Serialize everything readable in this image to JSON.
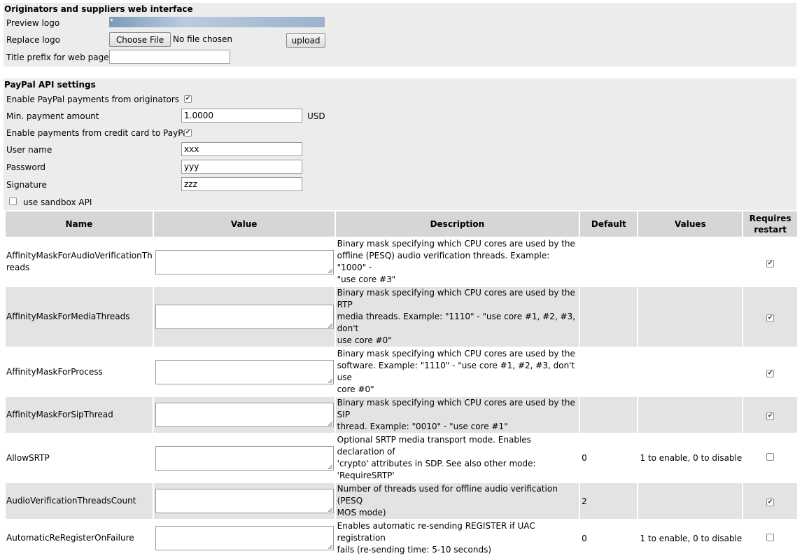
{
  "web_interface": {
    "title": "Originators and suppliers web interface",
    "preview_logo_label": "Preview logo",
    "replace_logo_label": "Replace logo",
    "choose_file_button": "Choose File",
    "no_file_text": "No file chosen",
    "upload_button": "upload",
    "title_prefix_label": "Title prefix for web pages",
    "title_prefix_value": ""
  },
  "paypal": {
    "title": "PayPal API settings",
    "enable_payments_label": "Enable PayPal payments from originators",
    "enable_payments_checked": true,
    "min_payment_label": "Min. payment amount",
    "min_payment_value": "1.0000",
    "currency": "USD",
    "enable_cc_label": "Enable payments from credit card to PayPal",
    "enable_cc_checked": true,
    "username_label": "User name",
    "username_value": "xxx",
    "password_label": "Password",
    "password_value": "yyy",
    "signature_label": "Signature",
    "signature_value": "zzz",
    "sandbox_label": "use sandbox API",
    "sandbox_checked": false
  },
  "settings_table": {
    "headers": {
      "name": "Name",
      "value": "Value",
      "description": "Description",
      "default": "Default",
      "values": "Values",
      "restart_line1": "Requires",
      "restart_line2": "restart"
    },
    "rows": [
      {
        "name_line1": "AffinityMaskForAudioVerificationTh",
        "name_line2": "reads",
        "desc1": "Binary mask specifying which CPU cores are used by the",
        "desc2": "offline (PESQ) audio verification threads. Example: \"1000\" -",
        "desc3": "\"use core #3\"",
        "default": "",
        "values": "",
        "restart": true
      },
      {
        "name_line1": "AffinityMaskForMediaThreads",
        "desc1": "Binary mask specifying which CPU cores are used by the RTP",
        "desc2": "media threads. Example: \"1110\" - \"use core #1, #2, #3, don't",
        "desc3": "use core #0\"",
        "default": "",
        "values": "",
        "restart": true
      },
      {
        "name_line1": "AffinityMaskForProcess",
        "desc1": "Binary mask specifying which CPU cores are used by the",
        "desc2": "software. Example: \"1110\" - \"use core #1, #2, #3, don't use",
        "desc3": "core #0\"",
        "default": "",
        "values": "",
        "restart": true
      },
      {
        "name_line1": "AffinityMaskForSipThread",
        "desc1": "Binary mask specifying which CPU cores are used by the SIP",
        "desc2": "thread. Example: \"0010\" - \"use core #1\"",
        "default": "",
        "values": "",
        "restart": true
      },
      {
        "name_line1": "AllowSRTP",
        "desc1": "Optional SRTP media transport mode. Enables declaration of",
        "desc2": "'crypto' attributes in SDP. See also other mode: 'RequireSRTP'",
        "default": "0",
        "values": "1 to enable, 0 to disable",
        "restart": false
      },
      {
        "name_line1": "AudioVerificationThreadsCount",
        "desc1": "Number of threads used for offline audio verification (PESQ",
        "desc2": "MOS mode)",
        "default": "2",
        "values": "",
        "restart": true
      },
      {
        "name_line1": "AutomaticReRegisterOnFailure",
        "desc1": "Enables automatic re-sending REGISTER if UAC registration",
        "desc2": "fails (re-sending time: 5-10 seconds)",
        "default": "0",
        "values": "1 to enable, 0 to disable",
        "restart": false
      }
    ]
  }
}
